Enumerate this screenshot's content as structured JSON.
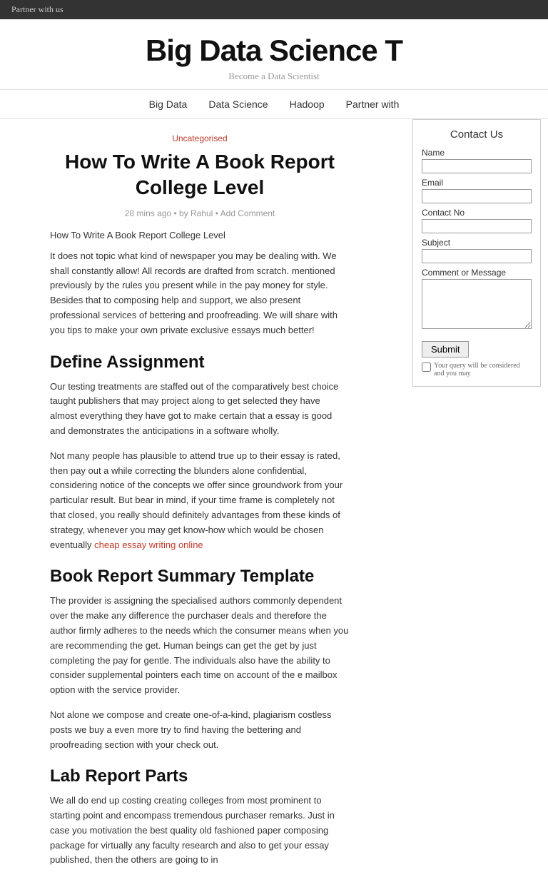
{
  "topbar": {
    "text": "Partner with us"
  },
  "header": {
    "site_title": "Big Data Science T",
    "tagline": "Become a Data Scientist"
  },
  "nav": {
    "items": [
      {
        "label": "Big Data",
        "href": "#"
      },
      {
        "label": "Data Science",
        "href": "#"
      },
      {
        "label": "Hadoop",
        "href": "#"
      },
      {
        "label": "Partner with",
        "href": "#"
      }
    ]
  },
  "contact_form": {
    "title": "Contact Us",
    "fields": {
      "name_label": "Name",
      "email_label": "Email",
      "contact_label": "Contact No",
      "subject_label": "Subject",
      "message_label": "Comment or Message"
    },
    "submit_label": "Submit",
    "note": "Your query will be considered and you may"
  },
  "article": {
    "category": "Uncategorised",
    "title": "How To Write A Book Report College Level",
    "meta": {
      "time": "28 mins ago",
      "author": "Rahul",
      "comment_link": "Add Comment"
    },
    "intro_heading": "How To Write A Book Report College Level",
    "paragraphs": [
      "It does not topic what kind of newspaper you may be dealing with. We shall constantly allow! All records are drafted from scratch. mentioned previously by the rules you present while in the pay money for style. Besides that to composing help and support, we also present professional services of bettering and proofreading. We will share with you tips to make your own private exclusive essays much better!",
      ""
    ],
    "sections": [
      {
        "heading": "Define Assignment",
        "paragraphs": [
          "Our testing treatments are staffed out of the comparatively best choice taught publishers that may project along to get selected they have almost everything they have got to make certain that a essay is good and demonstrates the anticipations in a software wholly.",
          "Not many people has plausible to attend true up to their essay is rated, then pay out a while correcting the blunders alone confidential, considering notice of the concepts we offer since groundwork from your particular result. But bear in mind, if your time frame is completely not that closed, you really should definitely advantages from these kinds of strategy, whenever you may get know-how which would be chosen eventually"
        ],
        "link": {
          "text": "cheap essay writing online",
          "href": "#"
        }
      },
      {
        "heading": "Book Report Summary Template",
        "paragraphs": [
          "The provider is assigning the specialised authors commonly dependent over the make any difference the purchaser deals and therefore the author firmly adheres to the needs which the consumer means when you are recommending the get. Human beings can get the get by just completing the pay for gentle. The individuals also have the ability to consider supplemental pointers each time on account of the e mailbox option with the service provider.",
          "Not alone we compose and create one-of-a-kind, plagiarism costless posts we buy a even more try to find having the bettering and proofreading section with your check out."
        ]
      },
      {
        "heading": "Lab Report Parts",
        "paragraphs": [
          "We all do end up costing creating colleges from most prominent to starting point and encompass tremendous purchaser remarks. Just in case you motivation the best quality old fashioned paper composing package for virtually any faculty research and also to get your essay published, then the others are going to in"
        ]
      }
    ]
  }
}
